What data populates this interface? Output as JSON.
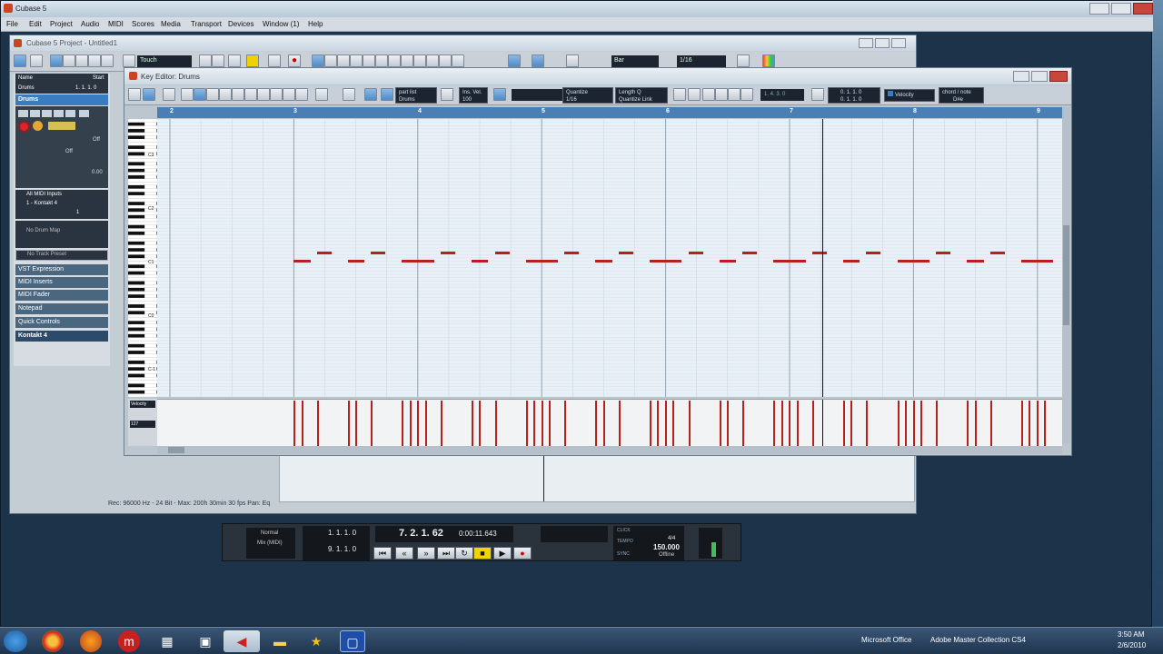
{
  "app": {
    "title": "Cubase 5"
  },
  "menu": [
    "File",
    "Edit",
    "Project",
    "Audio",
    "MIDI",
    "Scores",
    "Media",
    "Transport",
    "Devices",
    "Window (1)",
    "Help"
  ],
  "project": {
    "title": "Cubase 5 Project - Untitled1",
    "touch_mode": "Touch",
    "snap_value": "Bar",
    "quantize_value": "1/16",
    "status": "Rec: 96000 Hz - 24 Bit - Max: 200h 30min  30 fps  Pan: Eq"
  },
  "inspector": {
    "name_label": "Name",
    "start_label": "Start",
    "start_value": "1. 1. 1. 0",
    "track_name": "Drums",
    "off1": "Off",
    "off2": "Off",
    "value": "0.00",
    "midi_input": "All MIDI Inputs",
    "midi_output": "1 - Kontakt 4",
    "channel": "1",
    "drum_map": "No Drum Map",
    "bank": "No Track Preset",
    "sections": [
      "VST Expression",
      "MIDI Inserts",
      "MIDI Fader",
      "Notepad",
      "Quick Controls"
    ],
    "instrument": "Kontakt 4"
  },
  "key_editor": {
    "title": "Key Editor: Drums",
    "part_list_label": "part list",
    "part_list_value": "Drums",
    "insert_velocity_label": "Ins. Vel.",
    "insert_velocity_value": "100",
    "quantize_label": "Quantize",
    "quantize_value": "1/16",
    "length_label": "Length Q",
    "length_value": "Quantize Link",
    "position_left": "1. 4. 3. 0",
    "position_a": "0. 1. 1. 0",
    "position_b": "0. 1. 1. 0",
    "controller_label": "Velocity",
    "chord_label": "chord / note",
    "chord_value": "D#e",
    "velocity_lane_label": "Velocity",
    "velocity_max": "127",
    "ruler_bars": [
      "2",
      "3",
      "4",
      "5",
      "6",
      "7",
      "8",
      "9"
    ],
    "key_labels": [
      "C3",
      "C2",
      "C1",
      "C0",
      "C-1"
    ]
  },
  "transport": {
    "mode": "Normal",
    "mix": "Mix (MIDI)",
    "left_locator": "1. 1. 1. 0",
    "right_locator": "9. 1. 1. 0",
    "position": "7. 2. 1. 62",
    "time": "0:00:11.643",
    "click_label": "CLICK",
    "tempo_label": "TEMPO",
    "sync_label": "SYNC",
    "signature": "4/4",
    "tempo": "150.000",
    "sync_value": "Offline"
  },
  "taskbar": {
    "items": [
      "Microsoft Office",
      "Adobe Master Collection CS4"
    ],
    "time": "3:50 AM",
    "date": "2/6/2010"
  },
  "colors": {
    "note": "#b8201c",
    "ruler": "#4a7fb5",
    "grid": "#e9f1f7"
  }
}
